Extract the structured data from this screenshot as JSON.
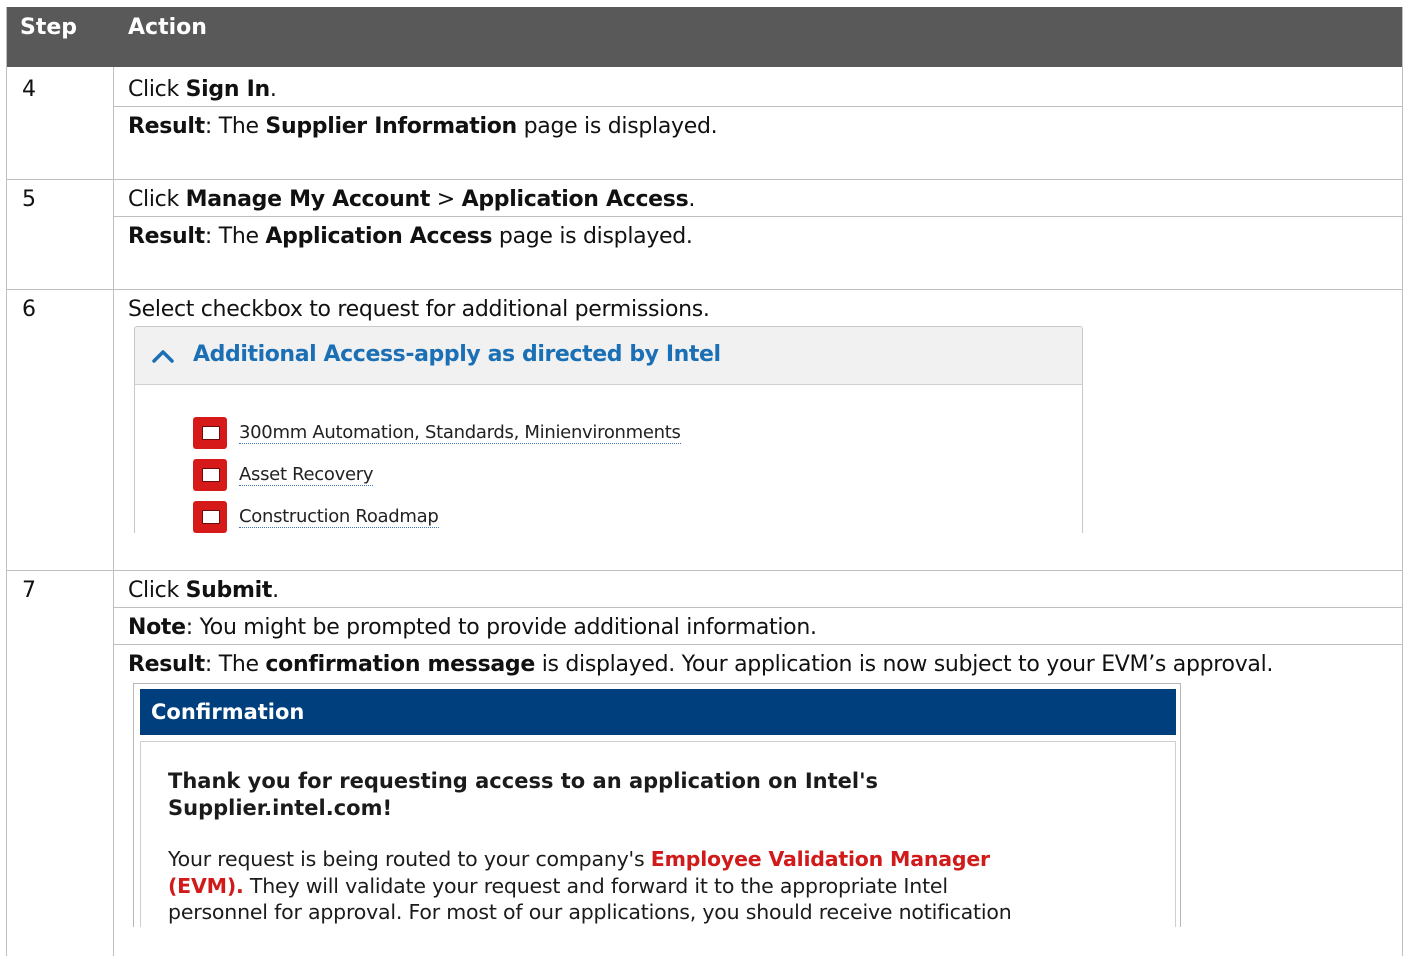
{
  "table": {
    "header": {
      "step": "Step",
      "action": "Action"
    },
    "rows": {
      "r4": {
        "step": "4",
        "l1": {
          "pre": "Click ",
          "b1": "Sign In",
          "post": "."
        },
        "l2": {
          "b0": "Result",
          "pre": ": The ",
          "b1": "Supplier Information",
          "post": " page is displayed."
        }
      },
      "r5": {
        "step": "5",
        "l1": {
          "pre": "Click ",
          "b1": "Manage My Account",
          "mid": " > ",
          "b2": "Application Access",
          "post": "."
        },
        "l2": {
          "b0": "Result",
          "pre": ": The ",
          "b1": "Application Access",
          "post": " page is displayed."
        }
      },
      "r6": {
        "step": "6",
        "l1": "Select checkbox to request for additional permissions."
      },
      "r7": {
        "step": "7",
        "l1": {
          "pre": "Click ",
          "b1": "Submit",
          "post": "."
        },
        "l2": {
          "b0": "Note",
          "post": ": You might be prompted to provide additional information."
        },
        "l3": {
          "b0": "Result",
          "pre": ": The ",
          "b1": "confirmation message",
          "post": " is displayed. Your application is now subject to your EVM’s approval."
        }
      }
    }
  },
  "access_panel": {
    "title": "Additional Access-apply as directed by Intel",
    "options": [
      "300mm Automation, Standards, Minienvironments",
      "Asset Recovery",
      "Construction Roadmap"
    ],
    "icons": {
      "collapse": "chevron-up-icon",
      "checkbox": "checkbox-icon"
    },
    "accent_color": "#1a6fb5",
    "checkbox_color": "#d61a1a"
  },
  "confirmation_panel": {
    "title": "Confirmation",
    "thanks_line1": "Thank you for requesting access to an application on Intel's",
    "thanks_line2": "Supplier.intel.com!",
    "body_pre": "Your request is being routed to your company's ",
    "body_red1": "Employee Validation Manager",
    "body_red2": "(EVM).",
    "body_post1": " They will validate your request and forward it to the appropriate Intel",
    "body_post2": "personnel for approval. For most of our applications, you should receive notification",
    "header_color": "#003f7d",
    "highlight_color": "#d11b1b"
  },
  "colors": {
    "table_header": "#595959",
    "grid": "#bfbfbf"
  }
}
